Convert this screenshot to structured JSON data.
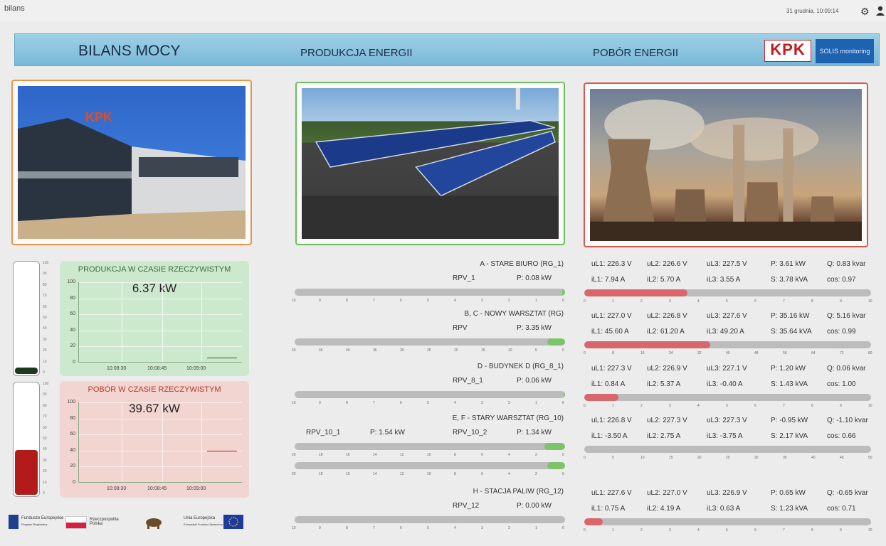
{
  "window": {
    "title": "bilans",
    "datetime": "31 grudnia, 10:09:14"
  },
  "header": {
    "title": "BILANS MOCY",
    "production": "PRODUKCJA ENERGII",
    "consumption": "POBÓR ENERGII",
    "brand": "KPK",
    "solis": "SOLIS monitoring"
  },
  "production_card": {
    "title": "PRODUKCJA W CZASIE RZECZYWISTYM",
    "value": "6.37 kW",
    "y_ticks": [
      "100",
      "80",
      "60",
      "40",
      "20",
      "0"
    ],
    "x_ticks": [
      "10:08:30",
      "10:08:45",
      "10:09:00"
    ],
    "level": 0.06
  },
  "consumption_card": {
    "title": "POBÓR W CZASIE RZECZYWISTYM",
    "value": "39.67 kW",
    "y_ticks": [
      "100",
      "80",
      "60",
      "40",
      "20",
      "0"
    ],
    "x_ticks": [
      "10:08:30",
      "10:08:45",
      "10:09:00"
    ],
    "level": 0.4
  },
  "thermo_scale": [
    "100",
    "90",
    "80",
    "70",
    "60",
    "50",
    "40",
    "30",
    "20",
    "10",
    "0"
  ],
  "production": [
    {
      "title": "A - STARE BIURO (RG_1)",
      "items": [
        {
          "name": "RPV_1",
          "power": "P: 0.08 kW",
          "fraction": 0.01
        }
      ],
      "scale": [
        "10",
        "9",
        "8",
        "7",
        "6",
        "5",
        "4",
        "3",
        "2",
        "1",
        "0"
      ]
    },
    {
      "title": "B, C - NOWY WARSZTAT (RG)",
      "items": [
        {
          "name": "RPV",
          "power": "P: 3.35 kW",
          "fraction": 0.067
        }
      ],
      "scale": [
        "50",
        "45",
        "40",
        "35",
        "30",
        "25",
        "20",
        "15",
        "10",
        "5",
        "0"
      ]
    },
    {
      "title": "D - BUDYNEK D (RG_8_1)",
      "items": [
        {
          "name": "RPV_8_1",
          "power": "P: 0.06 kW",
          "fraction": 0.006
        }
      ],
      "scale": [
        "10",
        "9",
        "8",
        "7",
        "6",
        "5",
        "4",
        "3",
        "2",
        "1",
        "0"
      ]
    },
    {
      "title": "E, F - STARY WARSZTAT (RG_10)",
      "items": [
        {
          "name": "RPV_10_1",
          "power": "P: 1.54 kW",
          "fraction": 0.077
        },
        {
          "name": "RPV_10_2",
          "power": "P: 1.34 kW",
          "fraction": 0.067
        }
      ],
      "scale": [
        "20",
        "18",
        "16",
        "14",
        "12",
        "10",
        "8",
        "6",
        "4",
        "2",
        "0"
      ]
    },
    {
      "title": "H - STACJA PALIW (RG_12)",
      "items": [
        {
          "name": "RPV_12",
          "power": "P: 0.00 kW",
          "fraction": 0.0
        }
      ],
      "scale": [
        "10",
        "9",
        "8",
        "7",
        "6",
        "5",
        "4",
        "3",
        "2",
        "1",
        "0"
      ]
    }
  ],
  "consumption": [
    {
      "uL1": "uL1: 226.3 V",
      "uL2": "uL2: 226.6 V",
      "uL3": "uL3: 227.5 V",
      "P": "P: 3.61 kW",
      "Q": "Q: 0.83 kvar",
      "iL1": "iL1: 7.94 A",
      "iL2": "iL2: 5.70 A",
      "iL3": "iL3: 3.55 A",
      "S": "S: 3.78 kVA",
      "cos": "cos: 0.97",
      "fraction": 0.36,
      "scale": [
        "0",
        "1",
        "2",
        "3",
        "4",
        "5",
        "6",
        "7",
        "8",
        "9",
        "10"
      ]
    },
    {
      "uL1": "uL1: 227.0 V",
      "uL2": "uL2: 226.8 V",
      "uL3": "uL3: 227.6 V",
      "P": "P: 35.16 kW",
      "Q": "Q: 5.16 kvar",
      "iL1": "iL1: 45.60 A",
      "iL2": "iL2: 61.20 A",
      "iL3": "iL3: 49.20 A",
      "S": "S: 35.64 kVA",
      "cos": "cos: 0.99",
      "fraction": 0.44,
      "scale": [
        "0",
        "8",
        "16",
        "24",
        "32",
        "40",
        "48",
        "56",
        "64",
        "72",
        "80"
      ]
    },
    {
      "uL1": "uL1: 227.3 V",
      "uL2": "uL2: 226.9 V",
      "uL3": "uL3: 227.1 V",
      "P": "P: 1.20 kW",
      "Q": "Q: 0.06 kvar",
      "iL1": "iL1: 0.84 A",
      "iL2": "iL2: 5.37 A",
      "iL3": "iL3: -0.40 A",
      "S": "S: 1.43 kVA",
      "cos": "cos: 1.00",
      "fraction": 0.12,
      "scale": [
        "0",
        "1",
        "2",
        "3",
        "4",
        "5",
        "6",
        "7",
        "8",
        "9",
        "10"
      ]
    },
    {
      "uL1": "uL1: 226.8 V",
      "uL2": "uL2: 227.3 V",
      "uL3": "uL3: 227.3 V",
      "P": "P: -0.95 kW",
      "Q": "Q: -1.10 kvar",
      "iL1": "iL1: -3.50 A",
      "iL2": "iL2: 2.75 A",
      "iL3": "iL3: -3.75 A",
      "S": "S: 2.17 kVA",
      "cos": "cos: 0.66",
      "fraction": 0.0,
      "scale": [
        "0",
        "5",
        "10",
        "15",
        "20",
        "25",
        "30",
        "35",
        "40",
        "45",
        "50"
      ]
    },
    {
      "uL1": "uL1: 227.6 V",
      "uL2": "uL2: 227.0 V",
      "uL3": "uL3: 226.9 V",
      "P": "P: 0.65 kW",
      "Q": "Q: -0.65 kvar",
      "iL1": "iL1: 0.75 A",
      "iL2": "iL2: 4.19 A",
      "iL3": "iL3: 0.63 A",
      "S": "S: 1.23 kVA",
      "cos": "cos: 0.71",
      "fraction": 0.065,
      "scale": [
        "0",
        "1",
        "2",
        "3",
        "4",
        "5",
        "6",
        "7",
        "8",
        "9",
        "10"
      ]
    }
  ],
  "logos": {
    "fe": "Fundusze Europejskie",
    "fe_sub": "Program Regionalny",
    "rp": "Rzeczpospolita Polska",
    "ue": "Unia Europejska",
    "ue_sub": "Europejski Fundusz Społeczny"
  },
  "colors": {
    "prod_fill": "#7cc46a",
    "cons_fill": "#d9666a",
    "thermo_prod": "#1e3a1e",
    "thermo_cons": "#b31b1b"
  }
}
